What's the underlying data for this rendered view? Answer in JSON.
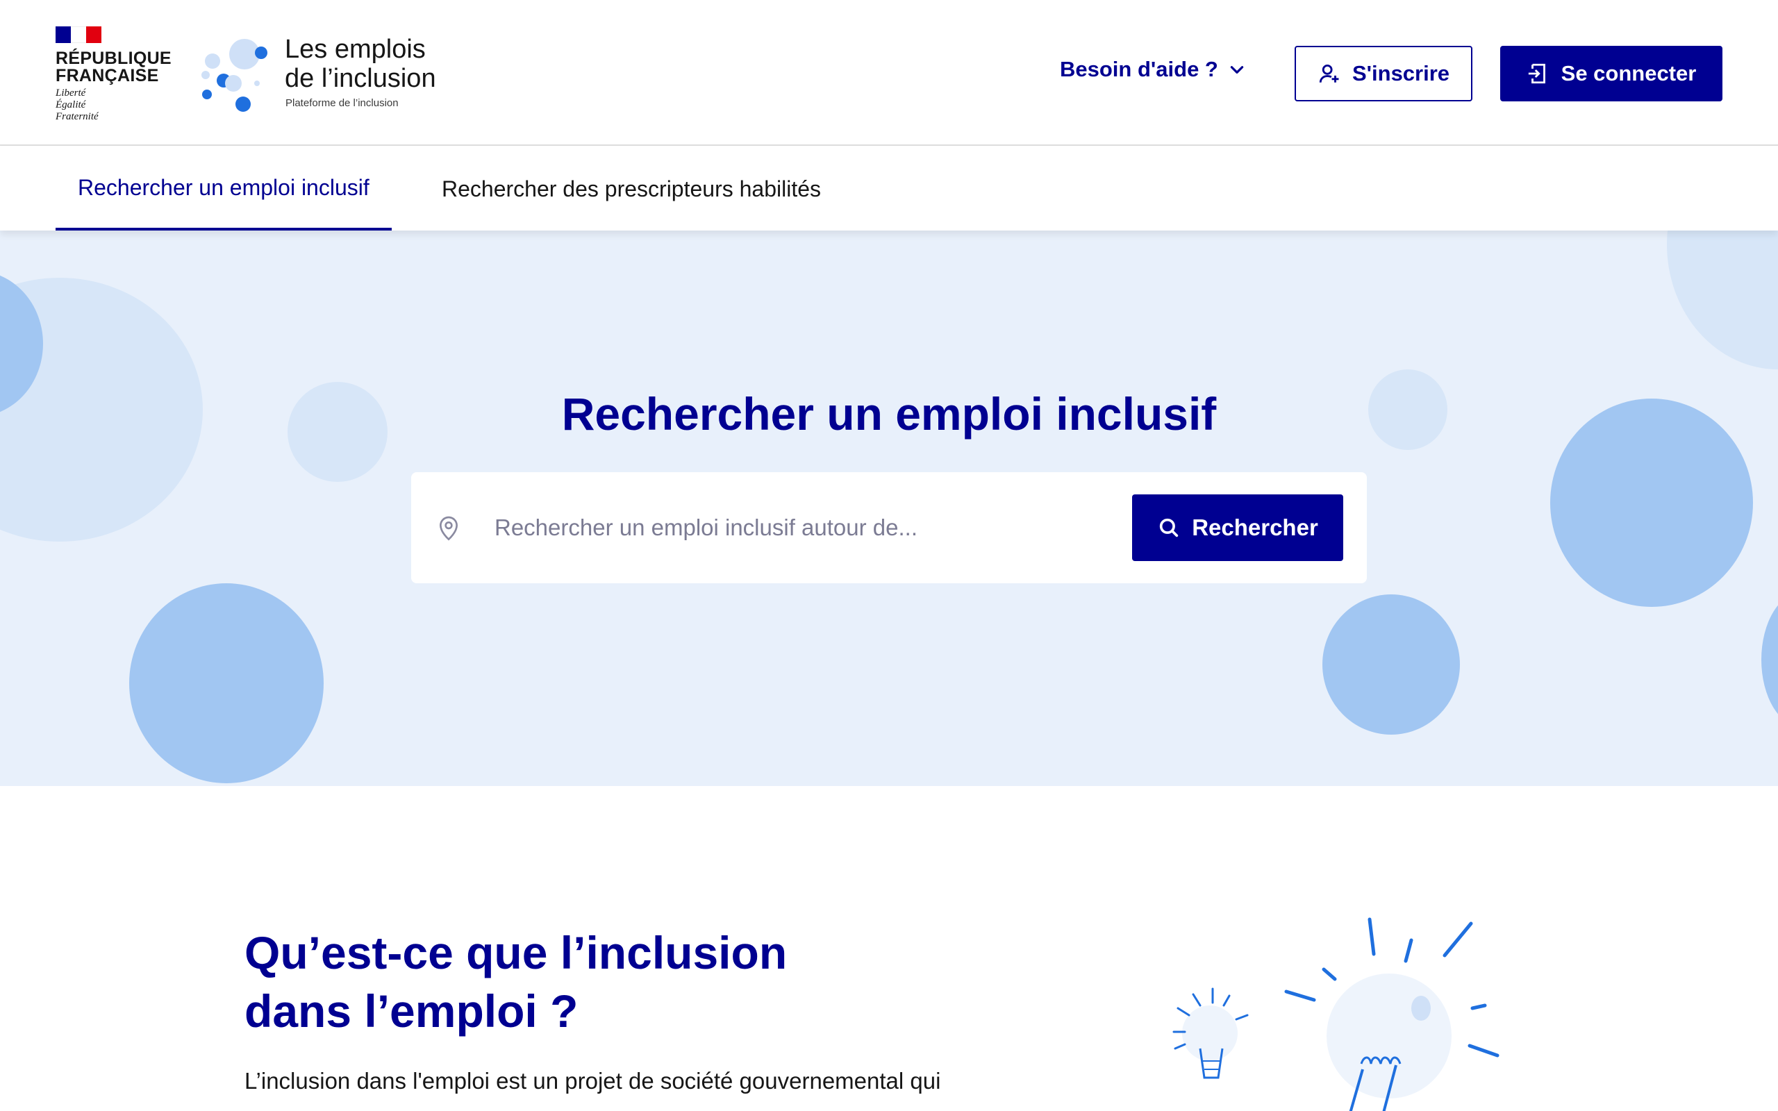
{
  "header": {
    "republic": {
      "line1": "RÉPUBLIQUE",
      "line2": "FRANÇAISE",
      "motto": [
        "Liberté",
        "Égalité",
        "Fraternité"
      ]
    },
    "brand": {
      "title_line1": "Les emplois",
      "title_line2": "de l’inclusion",
      "subtitle": "Plateforme de l’inclusion"
    },
    "help": {
      "label": "Besoin d'aide ?",
      "icon": "chevron-down-icon"
    },
    "signup": {
      "label": "S'inscrire",
      "icon": "user-add-icon"
    },
    "login": {
      "label": "Se connecter",
      "icon": "login-icon"
    }
  },
  "nav": {
    "tabs": [
      {
        "label": "Rechercher un emploi inclusif",
        "active": true
      },
      {
        "label": "Rechercher des prescripteurs habilités",
        "active": false
      }
    ]
  },
  "hero": {
    "title": "Rechercher un emploi inclusif",
    "search": {
      "placeholder": "Rechercher un emploi inclusif autour de...",
      "value": "",
      "button_label": "Rechercher",
      "location_icon": "map-pin-icon",
      "button_icon": "search-icon"
    }
  },
  "section": {
    "title_line1": "Qu’est-ce que l’inclusion",
    "title_line2": "dans l’emploi ?",
    "text": "L’inclusion dans l'emploi est un projet de société gouvernemental qui"
  },
  "colors": {
    "primary": "#000091",
    "hero_bg": "#e8f0fb",
    "bubble": "#a1c6f2",
    "bubble_light": "#d7e6f8"
  }
}
